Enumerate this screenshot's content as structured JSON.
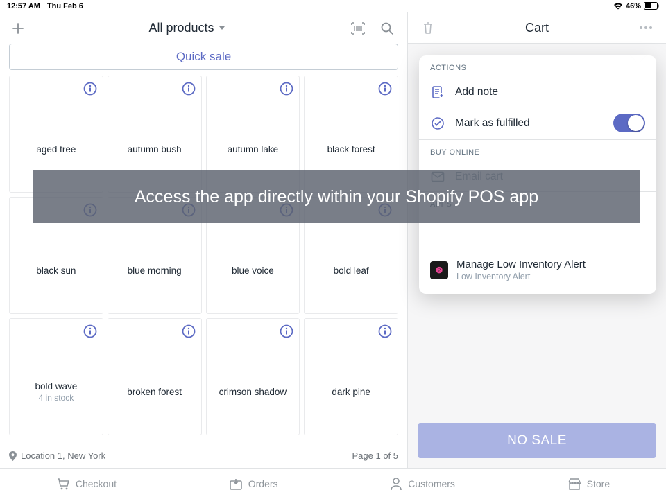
{
  "status": {
    "time": "12:57 AM",
    "date": "Thu Feb 6",
    "battery": "46%"
  },
  "header": {
    "title": "All products",
    "cart_title": "Cart"
  },
  "quick_sale": "Quick sale",
  "products": [
    {
      "name": "aged tree"
    },
    {
      "name": "autumn bush"
    },
    {
      "name": "autumn lake"
    },
    {
      "name": "black forest"
    },
    {
      "name": "black sun"
    },
    {
      "name": "blue morning"
    },
    {
      "name": "blue voice"
    },
    {
      "name": "bold leaf"
    },
    {
      "name": "bold wave",
      "stock": "4 in stock"
    },
    {
      "name": "broken forest"
    },
    {
      "name": "crimson shadow"
    },
    {
      "name": "dark pine"
    }
  ],
  "footer": {
    "location": "Location 1, New York",
    "page": "Page 1 of 5"
  },
  "no_sale": "NO SALE",
  "popover": {
    "actions_label": "ACTIONS",
    "add_note": "Add note",
    "mark_fulfilled": "Mark as fulfilled",
    "buy_online_label": "BUY ONLINE",
    "email_cart": "Email cart",
    "apps_label": "APPS",
    "app_title": "Manage Low Inventory Alert",
    "app_sub": "Low Inventory Alert"
  },
  "banner": "Access the app directly within your Shopify POS app",
  "tabs": {
    "checkout": "Checkout",
    "orders": "Orders",
    "customers": "Customers",
    "store": "Store"
  }
}
